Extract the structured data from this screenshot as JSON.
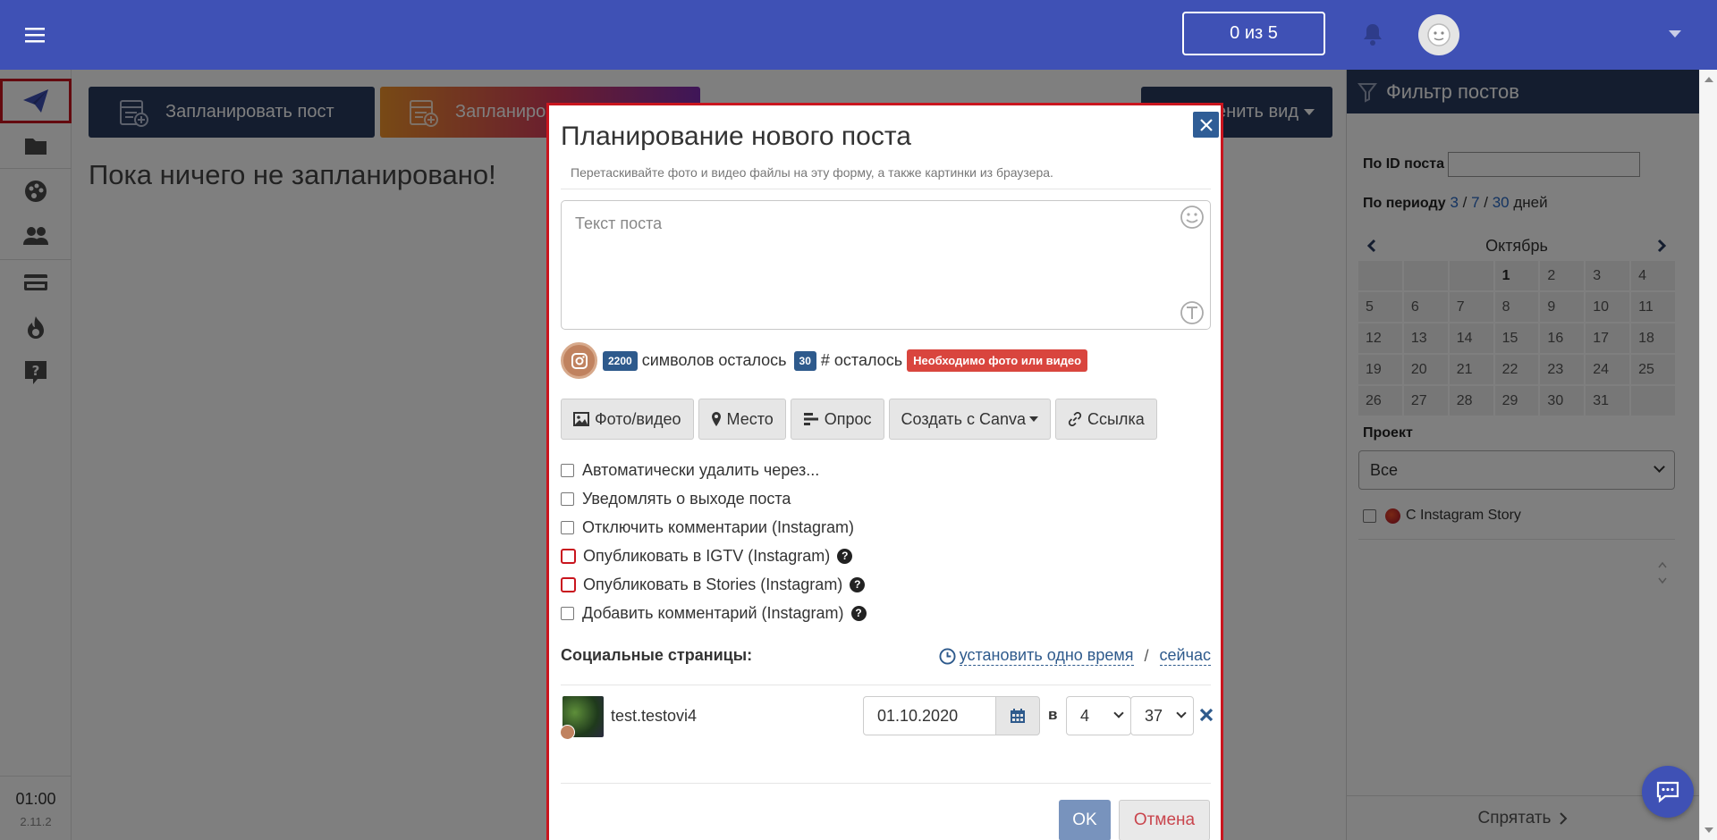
{
  "header": {
    "counter_label": "0 из 5"
  },
  "sidebar": {
    "items": [
      {
        "name": "send-icon",
        "active": true
      },
      {
        "name": "folder-icon"
      },
      {
        "name": "palette-icon"
      },
      {
        "name": "users-icon"
      },
      {
        "name": "credit-card-icon"
      },
      {
        "name": "fire-icon"
      },
      {
        "name": "help-icon"
      }
    ],
    "time": "01:00",
    "version": "2.11.2"
  },
  "main": {
    "schedule_post_label": "Запланировать пост",
    "schedule_story_label": "Запланиро",
    "change_view_label": "енить вид",
    "empty_message": "Пока ничего не запланировано!"
  },
  "filter": {
    "title": "Фильтр постов",
    "post_id_label": "По ID поста",
    "period_label": "По периоду",
    "period_3": "3",
    "period_7": "7",
    "period_30": "30",
    "period_sep": " / ",
    "period_days": "дней",
    "calendar": {
      "month": "Октябрь",
      "days": [
        "",
        "",
        "",
        "1",
        "2",
        "3",
        "4",
        "5",
        "6",
        "7",
        "8",
        "9",
        "10",
        "11",
        "12",
        "13",
        "14",
        "15",
        "16",
        "17",
        "18",
        "19",
        "20",
        "21",
        "22",
        "23",
        "24",
        "25",
        "26",
        "27",
        "28",
        "29",
        "30",
        "31",
        ""
      ]
    },
    "project_label": "Проект",
    "project_value": "Все",
    "story_label": "С Instagram Story",
    "hide_label": "Спрятать"
  },
  "modal": {
    "title": "Планирование нового поста",
    "hint": "Перетаскивайте фото и видео файлы на эту форму, а также картинки из браузера.",
    "text_placeholder": "Текст поста",
    "chars_count": "2200",
    "chars_label": "символов осталось",
    "tags_count": "30",
    "tags_label": "# осталось",
    "need_media": "Необходимо фото или видео",
    "tools": {
      "photo": "Фото/видео",
      "place": "Место",
      "poll": "Опрос",
      "canva": "Создать с Canva",
      "link": "Ссылка"
    },
    "checks": [
      {
        "label": "Автоматически удалить через...",
        "red": false,
        "help": false
      },
      {
        "label": "Уведомлять о выходе поста",
        "red": false,
        "help": false
      },
      {
        "label": "Отключить комментарии (Instagram)",
        "red": false,
        "help": false
      },
      {
        "label": "Опубликовать в IGTV (Instagram)",
        "red": true,
        "help": true
      },
      {
        "label": "Опубликовать в Stories (Instagram)",
        "red": true,
        "help": true
      },
      {
        "label": "Добавить комментарий (Instagram)",
        "red": false,
        "help": true
      }
    ],
    "social_label": "Социальные страницы:",
    "set_one_time": "установить одно время",
    "now_label": "сейчас",
    "slash": "/",
    "account": {
      "name": "test.testovi4",
      "date": "01.10.2020",
      "at": "в",
      "hour": "4",
      "minute": "37"
    },
    "ok_label": "OK",
    "cancel_label": "Отмена"
  },
  "colors": {
    "brand": "#3f51b5",
    "navy": "#283a5e",
    "highlight": "#c9151e"
  }
}
